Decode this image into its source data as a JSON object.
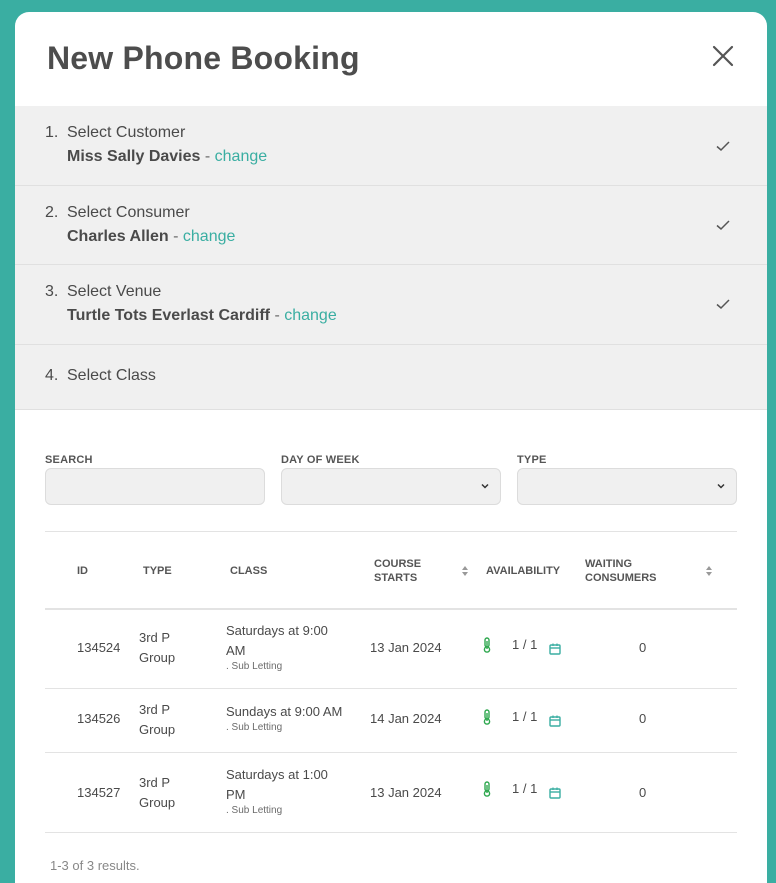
{
  "modal": {
    "title": "New Phone Booking"
  },
  "steps": [
    {
      "num": "1.",
      "title": "Select Customer",
      "detail": "Miss Sally Davies",
      "sep": " - ",
      "link": "change"
    },
    {
      "num": "2.",
      "title": "Select Consumer",
      "detail": "Charles Allen",
      "sep": " - ",
      "link": "change"
    },
    {
      "num": "3.",
      "title": "Select Venue",
      "detail": "Turtle Tots Everlast Cardiff",
      "sep": " - ",
      "link": "change"
    },
    {
      "num": "4.",
      "title": "Select Class"
    }
  ],
  "filters": {
    "search_label": "SEARCH",
    "day_label": "DAY OF WEEK",
    "type_label": "TYPE"
  },
  "table": {
    "headers": {
      "id": "ID",
      "type": "TYPE",
      "class": "CLASS",
      "course_starts_1": "COURSE",
      "course_starts_2": "STARTS",
      "availability": "AVAILABILITY",
      "waiting_1": "WAITING",
      "waiting_2": "CONSUMERS"
    },
    "rows": [
      {
        "id": "134524",
        "type1": "3rd P",
        "type2": "Group",
        "class1": "Saturdays at 9:00",
        "class2": "AM",
        "sub": ". Sub Letting",
        "starts": "13 Jan 2024",
        "avail": "1 / 1",
        "waiting": "0"
      },
      {
        "id": "134526",
        "type1": "3rd P",
        "type2": "Group",
        "class1": "Sundays at 9:00 AM",
        "class2": "",
        "sub": ". Sub Letting",
        "starts": "14 Jan 2024",
        "avail": "1 / 1",
        "waiting": "0"
      },
      {
        "id": "134527",
        "type1": "3rd P",
        "type2": "Group",
        "class1": "Saturdays at 1:00",
        "class2": "PM",
        "sub": ". Sub Letting",
        "starts": "13 Jan 2024",
        "avail": "1 / 1",
        "waiting": "0"
      }
    ]
  },
  "footer": {
    "count": "1-3 of 3 results."
  },
  "colors": {
    "accent": "#3aaea2",
    "therm_green": "#2fa84f"
  }
}
